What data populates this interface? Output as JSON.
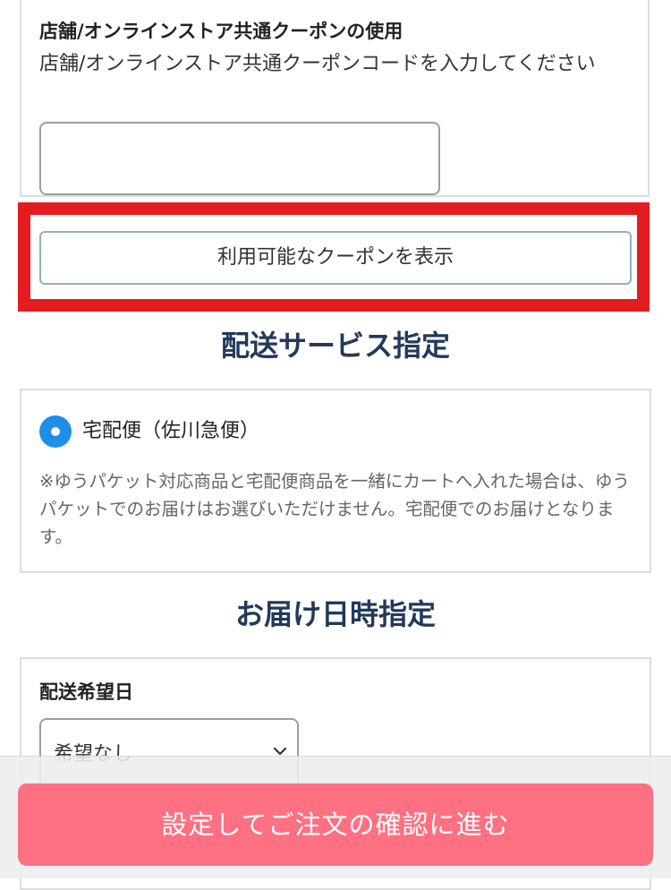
{
  "coupon": {
    "title": "店舗/オンラインストア共通クーポンの使用",
    "description": "店舗/オンラインストア共通クーポンコードを入力してください",
    "input_value": "",
    "show_button_label": "利用可能なクーポンを表示"
  },
  "delivery_service": {
    "heading": "配送サービス指定",
    "option_label": "宅配便（佐川急便）",
    "option_selected": true,
    "note": "※ゆうパケット対応商品と宅配便商品を一緒にカートへ入れた場合は、ゆうパケットでのお届けはお選びいただけません。宅配便でのお届けとなります。"
  },
  "delivery_datetime": {
    "heading": "お届け日時指定",
    "date_label": "配送希望日",
    "date_selected": "希望なし"
  },
  "footer": {
    "confirm_label": "設定してご注文の確認に進む"
  },
  "colors": {
    "heading": "#23395b",
    "radio_accent": "#1e8ee6",
    "highlight_border": "#e31c20",
    "confirm_button": "#fd7183"
  },
  "icons": {
    "radio": "radio-selected-icon",
    "select": "chevron-down-icon"
  }
}
